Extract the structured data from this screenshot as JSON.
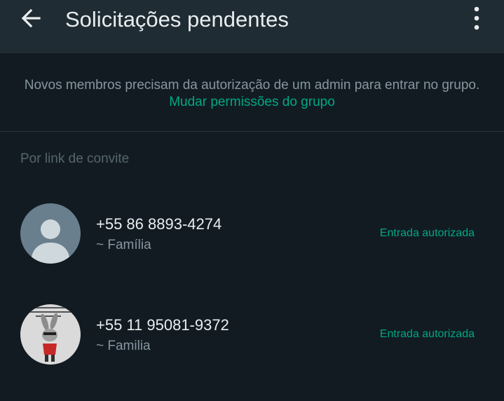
{
  "header": {
    "title": "Solicitações pendentes",
    "back_icon": "arrow-left-icon",
    "menu_icon": "more-vertical-icon"
  },
  "notice": {
    "text": "Novos membros precisam da autorização de um admin para entrar no grupo.",
    "link_label": "Mudar permissões do grupo"
  },
  "section": {
    "label": "Por link de convite"
  },
  "requests": [
    {
      "phone": "+55 86 8893-4274",
      "group": "~ Família",
      "status": "Entrada autorizada",
      "avatar": "default-avatar-icon"
    },
    {
      "phone": "+55 11 95081-9372",
      "group": "~ Familia",
      "status": "Entrada autorizada",
      "avatar": "rabbit-photo"
    }
  ],
  "colors": {
    "background": "#121b22",
    "app_bar": "#1f2c34",
    "accent": "#00a884",
    "primary_text": "#e9edef",
    "secondary_text": "#8696a0"
  }
}
